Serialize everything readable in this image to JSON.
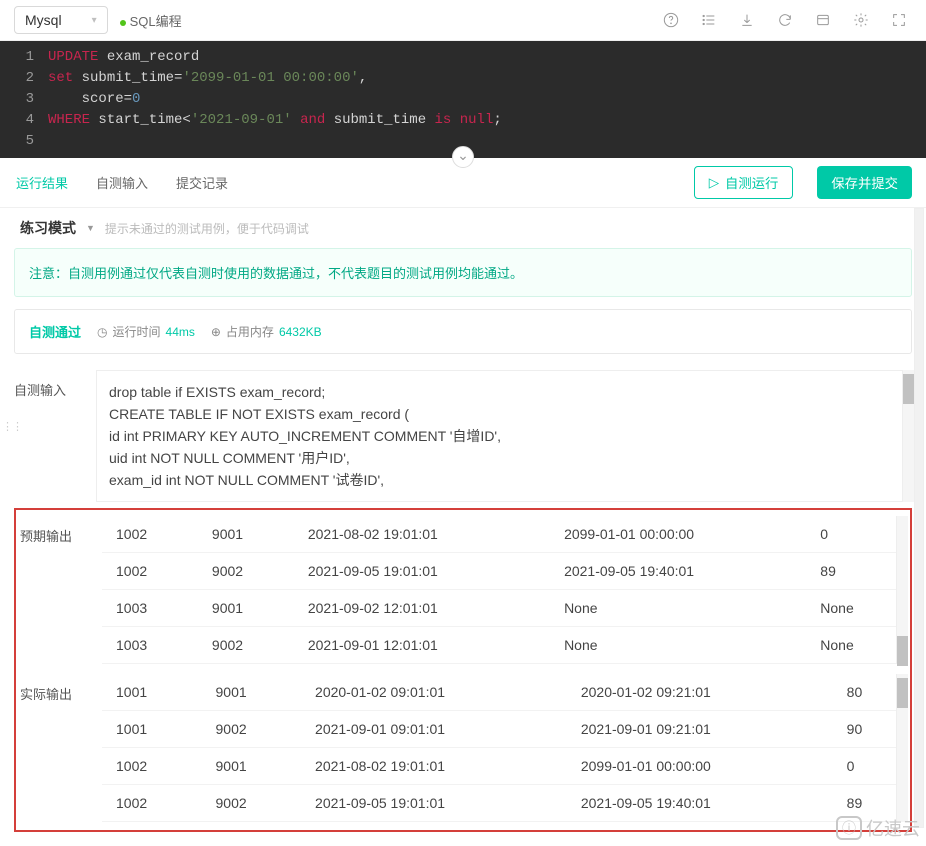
{
  "toolbar": {
    "db": "Mysql",
    "mode": "SQL编程"
  },
  "code": {
    "l1": "UPDATE exam_record",
    "l2": "set submit_time='2099-01-01 00:00:00',",
    "l3": "    score=0",
    "l4": "WHERE start_time<'2021-09-01' and submit_time is null;"
  },
  "tabs": {
    "results": "运行结果",
    "self_input": "自测输入",
    "history": "提交记录"
  },
  "buttons": {
    "self_run": "自测运行",
    "save_submit": "保存并提交"
  },
  "mode": {
    "label": "练习模式",
    "hint": "提示未通过的测试用例，便于代码调试"
  },
  "notice": "注意：自测用例通过仅代表自测时使用的数据通过，不代表题目的测试用例均能通过。",
  "status": {
    "pass": "自测通过",
    "time_label": "运行时间",
    "time": "44ms",
    "mem_label": "占用内存",
    "mem": "6432KB"
  },
  "labels": {
    "input": "自测输入",
    "expected": "预期输出",
    "actual": "实际输出"
  },
  "input_sql": [
    "drop table if EXISTS exam_record;",
    "CREATE TABLE IF NOT EXISTS exam_record (",
    "id int PRIMARY KEY AUTO_INCREMENT COMMENT '自增ID',",
    "uid int NOT NULL COMMENT '用户ID',",
    "exam_id int NOT NULL COMMENT '试卷ID',"
  ],
  "expected": [
    [
      "1002",
      "9001",
      "2021-08-02 19:01:01",
      "2099-01-01 00:00:00",
      "0"
    ],
    [
      "1002",
      "9002",
      "2021-09-05 19:01:01",
      "2021-09-05 19:40:01",
      "89"
    ],
    [
      "1003",
      "9001",
      "2021-09-02 12:01:01",
      "None",
      "None"
    ],
    [
      "1003",
      "9002",
      "2021-09-01 12:01:01",
      "None",
      "None"
    ]
  ],
  "actual": [
    [
      "1001",
      "9001",
      "2020-01-02 09:01:01",
      "2020-01-02 09:21:01",
      "80"
    ],
    [
      "1001",
      "9002",
      "2021-09-01 09:01:01",
      "2021-09-01 09:21:01",
      "90"
    ],
    [
      "1002",
      "9001",
      "2021-08-02 19:01:01",
      "2099-01-01 00:00:00",
      "0"
    ],
    [
      "1002",
      "9002",
      "2021-09-05 19:01:01",
      "2021-09-05 19:40:01",
      "89"
    ]
  ],
  "watermark": "亿速云"
}
